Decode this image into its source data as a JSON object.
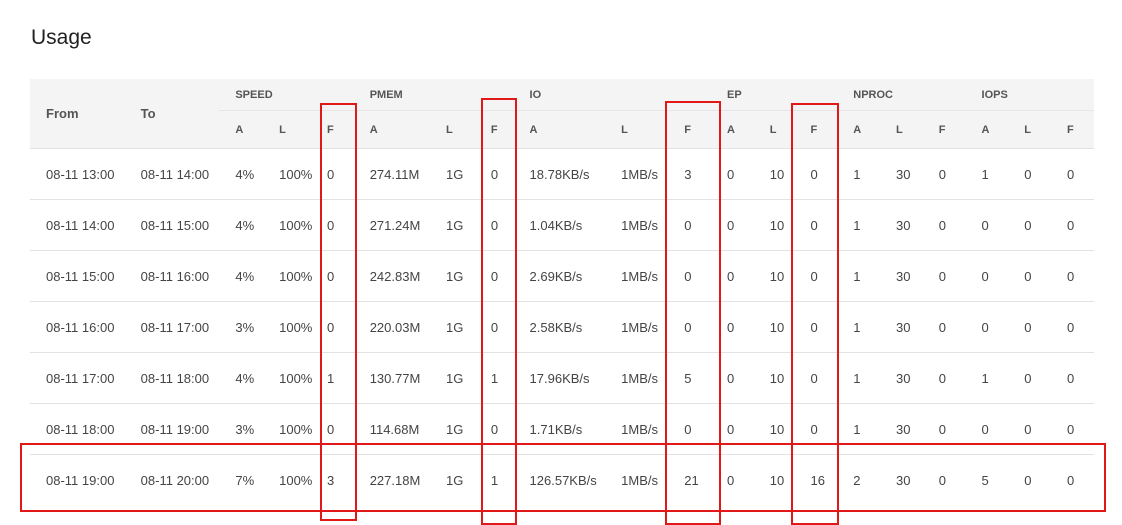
{
  "page": {
    "title": "Usage"
  },
  "table": {
    "col_from": "From",
    "col_to": "To",
    "groups": [
      "SPEED",
      "PMEM",
      "IO",
      "EP",
      "NPROC",
      "IOPS"
    ],
    "sub": [
      "A",
      "L",
      "F"
    ],
    "rows": [
      [
        "08-11 13:00",
        "08-11 14:00",
        "4%",
        "100%",
        "0",
        "274.11M",
        "1G",
        "0",
        "18.78KB/s",
        "1MB/s",
        "3",
        "0",
        "10",
        "0",
        "1",
        "30",
        "0",
        "1",
        "0",
        "0"
      ],
      [
        "08-11 14:00",
        "08-11 15:00",
        "4%",
        "100%",
        "0",
        "271.24M",
        "1G",
        "0",
        "1.04KB/s",
        "1MB/s",
        "0",
        "0",
        "10",
        "0",
        "1",
        "30",
        "0",
        "0",
        "0",
        "0"
      ],
      [
        "08-11 15:00",
        "08-11 16:00",
        "4%",
        "100%",
        "0",
        "242.83M",
        "1G",
        "0",
        "2.69KB/s",
        "1MB/s",
        "0",
        "0",
        "10",
        "0",
        "1",
        "30",
        "0",
        "0",
        "0",
        "0"
      ],
      [
        "08-11 16:00",
        "08-11 17:00",
        "3%",
        "100%",
        "0",
        "220.03M",
        "1G",
        "0",
        "2.58KB/s",
        "1MB/s",
        "0",
        "0",
        "10",
        "0",
        "1",
        "30",
        "0",
        "0",
        "0",
        "0"
      ],
      [
        "08-11 17:00",
        "08-11 18:00",
        "4%",
        "100%",
        "1",
        "130.77M",
        "1G",
        "1",
        "17.96KB/s",
        "1MB/s",
        "5",
        "0",
        "10",
        "0",
        "1",
        "30",
        "0",
        "1",
        "0",
        "0"
      ],
      [
        "08-11 18:00",
        "08-11 19:00",
        "3%",
        "100%",
        "0",
        "114.68M",
        "1G",
        "0",
        "1.71KB/s",
        "1MB/s",
        "0",
        "0",
        "10",
        "0",
        "1",
        "30",
        "0",
        "0",
        "0",
        "0"
      ],
      [
        "08-11 19:00",
        "08-11 20:00",
        "7%",
        "100%",
        "3",
        "227.18M",
        "1G",
        "1",
        "126.57KB/s",
        "1MB/s",
        "21",
        "0",
        "10",
        "16",
        "2",
        "30",
        "0",
        "5",
        "0",
        "0"
      ]
    ]
  },
  "annotations": {
    "color": "#e01818"
  }
}
